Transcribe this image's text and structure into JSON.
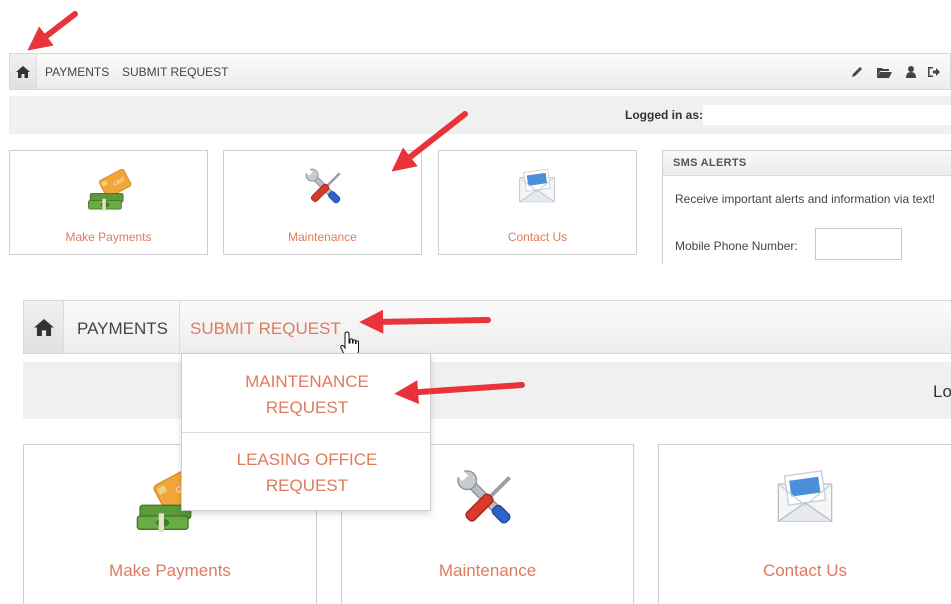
{
  "top": {
    "nav": {
      "payments": "PAYMENTS",
      "submit": "SUBMIT REQUEST"
    },
    "logged_in": "Logged in as:",
    "tiles": [
      {
        "label": "Make Payments"
      },
      {
        "label": "Maintenance"
      },
      {
        "label": "Contact Us"
      }
    ],
    "sms": {
      "header": "SMS ALERTS",
      "description": "Receive important alerts and information via text!",
      "phone_label": "Mobile Phone Number:",
      "phone_value": ""
    }
  },
  "bottom": {
    "nav": {
      "payments": "PAYMENTS",
      "submit": "SUBMIT REQUEST"
    },
    "logged_in_partial": "Lo",
    "dropdown": [
      {
        "label": "MAINTENANCE REQUEST"
      },
      {
        "label": "LEASING OFFICE REQUEST"
      }
    ],
    "tiles": [
      {
        "label": "Make Payments"
      },
      {
        "label": "Maintenance"
      },
      {
        "label": "Contact Us"
      }
    ]
  },
  "card_text": "Card",
  "colors": {
    "accent": "#e07a5f",
    "arrow": "#e8333a",
    "nav_bg": "#f1f1f1"
  },
  "icons": [
    "home-icon",
    "pencil-icon",
    "folder-open-icon",
    "user-icon",
    "sign-out-icon",
    "pointer-hand-icon"
  ]
}
